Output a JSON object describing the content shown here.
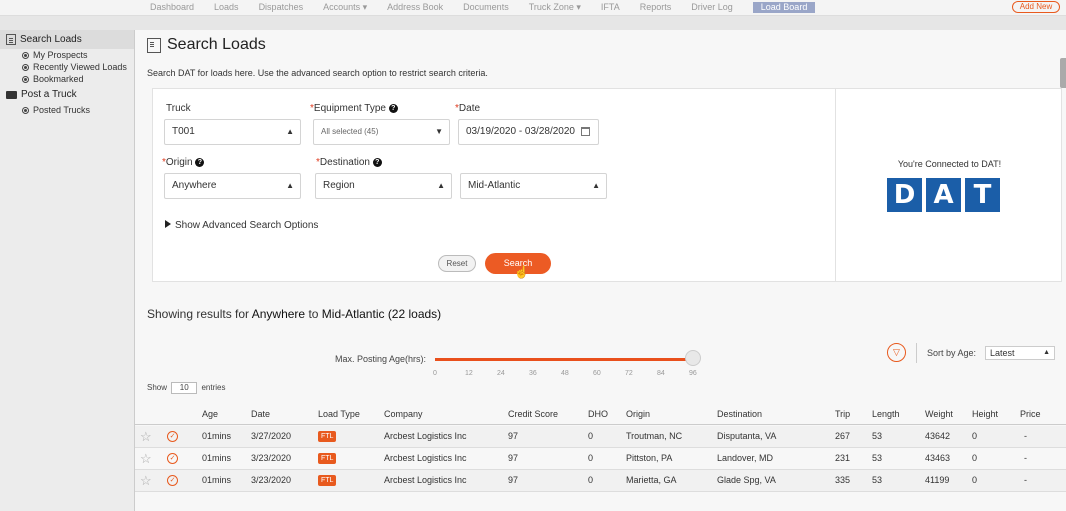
{
  "nav": {
    "items": [
      "Dashboard",
      "Loads",
      "Dispatches",
      "Accounts ▾",
      "Address Book",
      "Documents",
      "Truck Zone ▾",
      "IFTA",
      "Reports",
      "Driver Log",
      "Load Board"
    ],
    "right_button": "Add New"
  },
  "sidebar": {
    "search_loads": "Search Loads",
    "my_prospects": "My Prospects",
    "recently_viewed": "Recently Viewed Loads",
    "bookmarked": "Bookmarked",
    "post_truck": "Post a Truck",
    "posted_trucks": "Posted Trucks"
  },
  "page": {
    "title": "Search Loads",
    "description": "Search DAT for loads here. Use the advanced search option to restrict search criteria."
  },
  "form": {
    "truck_label": "Truck",
    "truck_value": "T001",
    "equipment_label": "Equipment Type",
    "equipment_value": "All selected (45)",
    "date_label": "Date",
    "date_value": "03/19/2020 - 03/28/2020",
    "origin_label": "Origin",
    "origin_value": "Anywhere",
    "destination_label": "Destination",
    "destination_type": "Region",
    "destination_value": "Mid-Atlantic",
    "advanced": "Show Advanced Search Options",
    "reset": "Reset",
    "search": "Search",
    "required_mark": "*",
    "help_mark": "?"
  },
  "dat": {
    "connected": "You're Connected to DAT!",
    "logo_letters": [
      "D",
      "A",
      "T"
    ]
  },
  "results": {
    "prefix": "Showing results for",
    "origin": "Anywhere",
    "to": "to",
    "destination": "Mid-Atlantic (22 loads)"
  },
  "age_filter": {
    "label": "Max. Posting Age(hrs):",
    "ticks": [
      "0",
      "12",
      "24",
      "36",
      "48",
      "60",
      "72",
      "84",
      "96"
    ]
  },
  "sort": {
    "label": "Sort by Age:",
    "value": "Latest"
  },
  "entries": {
    "show": "Show",
    "count": "10",
    "suffix": "entries"
  },
  "table": {
    "headers": [
      "Age",
      "Date",
      "Load Type",
      "Company",
      "Credit Score",
      "DHO",
      "Origin",
      "Destination",
      "Trip",
      "Length",
      "Weight",
      "Height",
      "Price"
    ],
    "rows": [
      [
        "01mins",
        "3/27/2020",
        "FTL",
        "Arcbest Logistics Inc",
        "97",
        "0",
        "Troutman, NC",
        "Disputanta, VA",
        "267",
        "53",
        "43642",
        "0",
        "-"
      ],
      [
        "01mins",
        "3/23/2020",
        "FTL",
        "Arcbest Logistics Inc",
        "97",
        "0",
        "Pittston, PA",
        "Landover, MD",
        "231",
        "53",
        "43463",
        "0",
        "-"
      ],
      [
        "01mins",
        "3/23/2020",
        "FTL",
        "Arcbest Logistics Inc",
        "97",
        "0",
        "Marietta, GA",
        "Glade Spg, VA",
        "335",
        "53",
        "41199",
        "0",
        "-"
      ]
    ]
  },
  "colors": {
    "accent": "#ec5b24",
    "dat_blue": "#1b5ea8"
  }
}
